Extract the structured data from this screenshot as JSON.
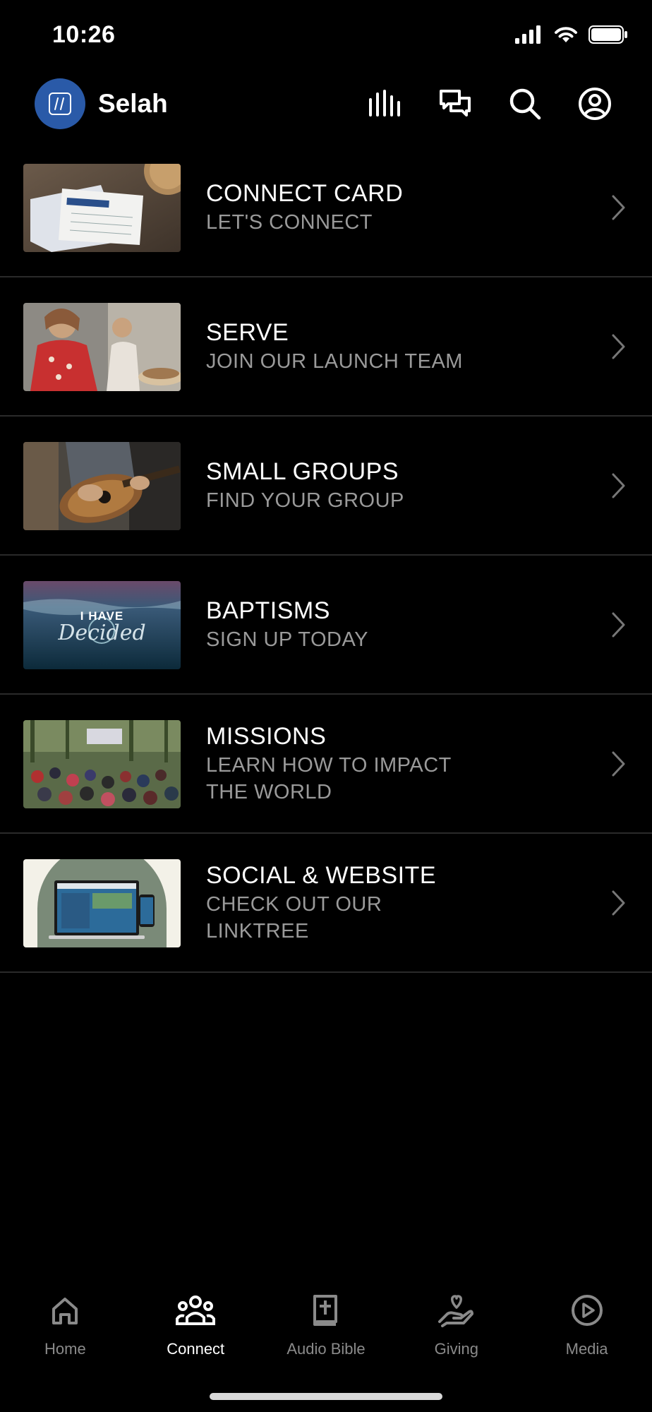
{
  "status_bar": {
    "time": "10:26"
  },
  "header": {
    "app_name": "Selah",
    "logo_glyph": "//",
    "actions": [
      {
        "name": "audio-bars-icon"
      },
      {
        "name": "chat-icon"
      },
      {
        "name": "search-icon"
      },
      {
        "name": "profile-icon"
      }
    ]
  },
  "items": [
    {
      "title": "CONNECT CARD",
      "subtitle": "LET'S CONNECT"
    },
    {
      "title": "SERVE",
      "subtitle": "JOIN OUR LAUNCH TEAM"
    },
    {
      "title": "SMALL GROUPS",
      "subtitle": "FIND YOUR GROUP"
    },
    {
      "title": "BAPTISMS",
      "subtitle": "SIGN UP TODAY",
      "thumb_text_1": "I HAVE",
      "thumb_text_2": "Decided"
    },
    {
      "title": "MISSIONS",
      "subtitle": "LEARN HOW TO IMPACT THE WORLD"
    },
    {
      "title": "SOCIAL & WEBSITE",
      "subtitle": "CHECK OUT OUR LINKTREE"
    }
  ],
  "tabs": [
    {
      "label": "Home",
      "icon": "home-icon",
      "active": false
    },
    {
      "label": "Connect",
      "icon": "people-icon",
      "active": true
    },
    {
      "label": "Audio Bible",
      "icon": "bible-icon",
      "active": false
    },
    {
      "label": "Giving",
      "icon": "giving-hand-icon",
      "active": false
    },
    {
      "label": "Media",
      "icon": "play-circle-icon",
      "active": false
    }
  ],
  "colors": {
    "background": "#000000",
    "accent_logo": "#2a5aa8",
    "subtitle": "#9a9a9a",
    "divider": "#2a2a2a"
  }
}
